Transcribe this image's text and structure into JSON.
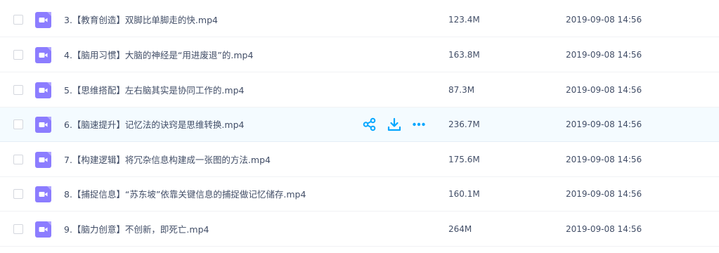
{
  "files": [
    {
      "name": "3.【教育创造】双脚比单脚走的快.mp4",
      "size": "123.4M",
      "modified": "2019-09-08 14:56"
    },
    {
      "name": "4.【脑用习惯】大脑的神经是“用进废退”的.mp4",
      "size": "163.8M",
      "modified": "2019-09-08 14:56"
    },
    {
      "name": "5.【思维搭配】左右脑其实是协同工作的.mp4",
      "size": "87.3M",
      "modified": "2019-09-08 14:56"
    },
    {
      "name": "6.【脑速提升】记忆法的诀窍是思维转换.mp4",
      "size": "236.7M",
      "modified": "2019-09-08 14:56"
    },
    {
      "name": "7.【构建逻辑】将冗杂信息构建成一张图的方法.mp4",
      "size": "175.6M",
      "modified": "2019-09-08 14:56"
    },
    {
      "name": "8.【捕捉信息】“苏东坡”依靠关键信息的捕捉做记忆储存.mp4",
      "size": "160.1M",
      "modified": "2019-09-08 14:56"
    },
    {
      "name": "9.【脑力创意】不创新，即死亡.mp4",
      "size": "264M",
      "modified": "2019-09-08 14:56"
    }
  ],
  "hovered_row": 3,
  "row_actions": [
    {
      "icon": "share-icon"
    },
    {
      "icon": "download-icon"
    },
    {
      "icon": "more-icon"
    }
  ],
  "colors": {
    "text": "#424e67",
    "accent": "#06a7ff",
    "video_icon": "#8c7dff",
    "hover_bg": "#f4fbff",
    "divider": "#f1f2f5"
  }
}
